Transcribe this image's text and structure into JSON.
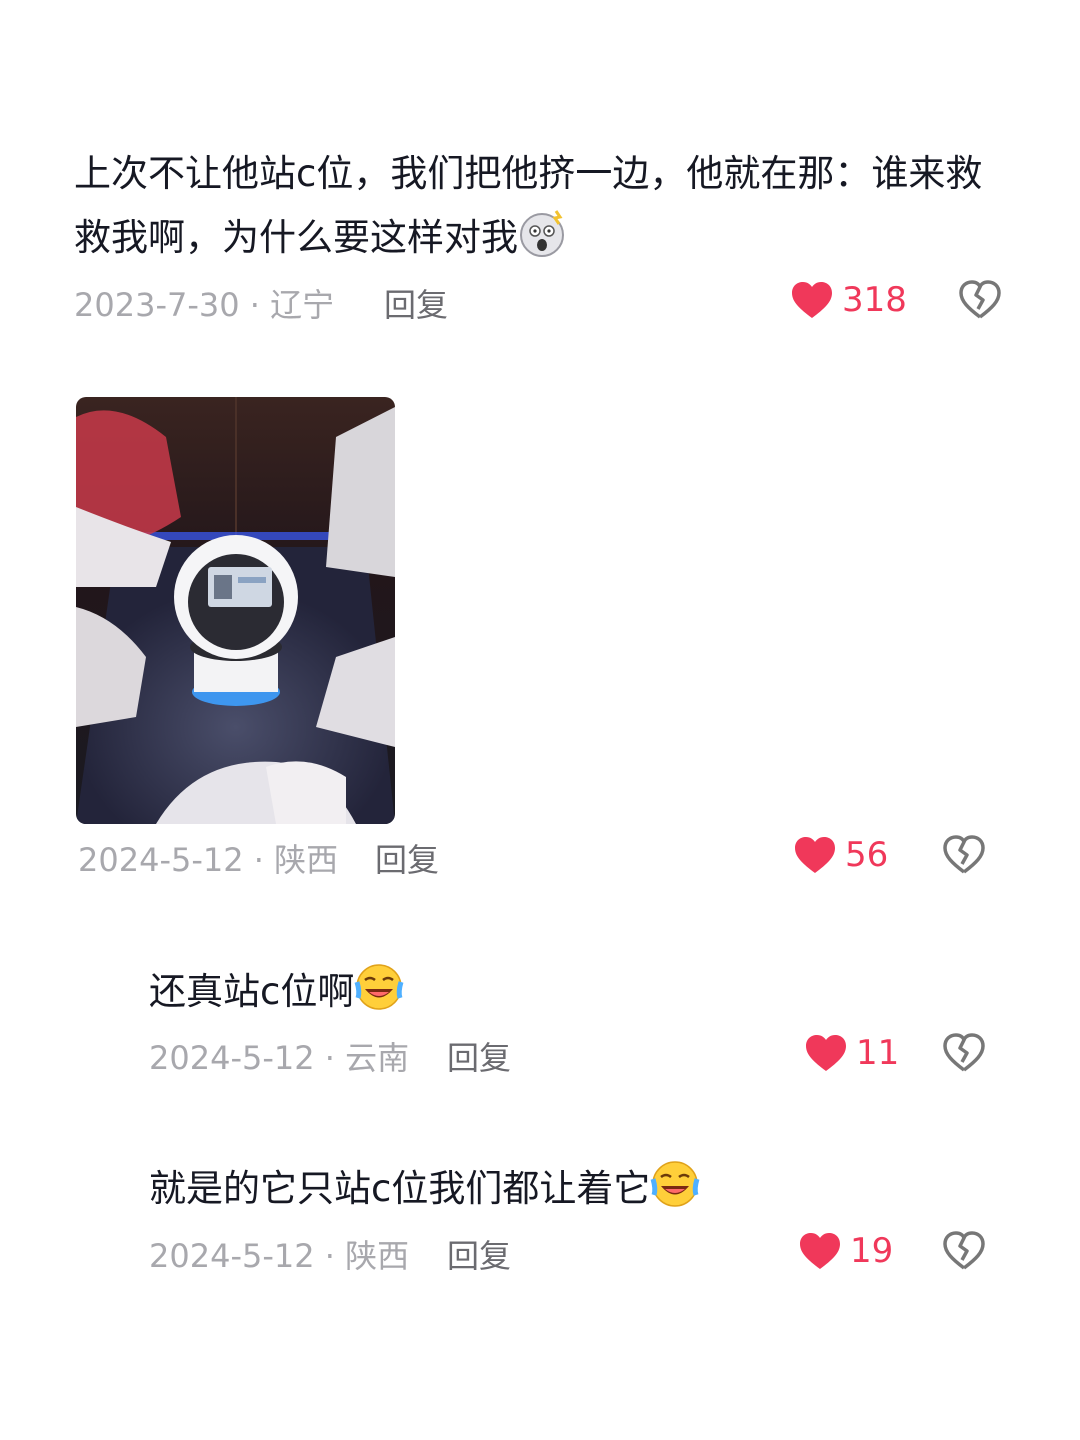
{
  "comments": [
    {
      "text": "上次不让他站c位，我们把他挤一边，他就在那：谁来救救我啊，为什么要这样对我",
      "emoji": "shocked-face",
      "date_region": "2023-7-30 · 辽宁",
      "reply_label": "回复",
      "likes": "318"
    },
    {
      "date_region": "2024-5-12 · 陕西",
      "reply_label": "回复",
      "likes": "56"
    },
    {
      "text": "还真站c位啊",
      "emoji": "laughing-crying-face",
      "date_region": "2024-5-12 · 云南",
      "reply_label": "回复",
      "likes": "11"
    },
    {
      "text": "就是的它只站c位我们都让着它",
      "emoji": "laughing-crying-face",
      "date_region": "2024-5-12 · 陕西",
      "reply_label": "回复",
      "likes": "19"
    }
  ],
  "colors": {
    "like": "#f0385a",
    "meta": "#a8a8ad",
    "reply": "#6b6b70",
    "text": "#161823"
  },
  "icons": {
    "like": "heart-icon",
    "dislike": "broken-heart-icon"
  }
}
